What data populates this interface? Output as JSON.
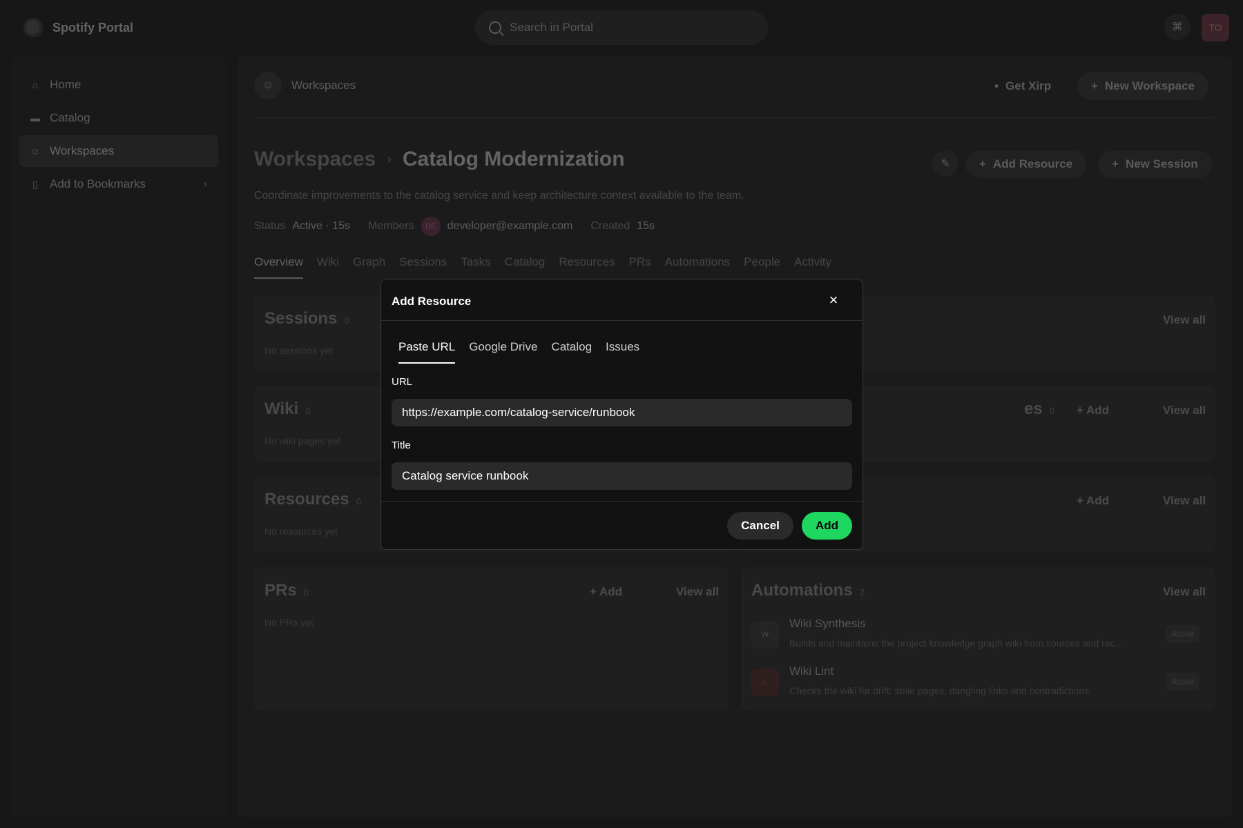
{
  "app": {
    "name": "Spotify Portal"
  },
  "topbar": {
    "search_placeholder": "Search in Portal",
    "avatar_initials": "TO"
  },
  "sidebar": {
    "items": [
      {
        "label": "Home",
        "icon": "home-icon"
      },
      {
        "label": "Catalog",
        "icon": "folder-icon"
      },
      {
        "label": "Workspaces",
        "icon": "users-icon",
        "active": true
      },
      {
        "label": "Add to Bookmarks",
        "icon": "bookmark-icon"
      }
    ]
  },
  "header": {
    "title": "Workspaces",
    "get_xirp": "Get Xirp",
    "new_workspace": "New Workspace"
  },
  "workspace": {
    "breadcrumb_parent": "Workspaces",
    "name": "Catalog Modernization",
    "add_resource": "Add Resource",
    "new_session": "New Session",
    "description": "Coordinate improvements to the catalog service and keep architecture context available to the team.",
    "status_label": "Status",
    "status_value": "Active · 15s",
    "members_label": "Members",
    "member_initials": "DE",
    "member_email": "developer@example.com",
    "created_label": "Created",
    "created_value": "15s"
  },
  "tabs": [
    "Overview",
    "Wiki",
    "Graph",
    "Sessions",
    "Tasks",
    "Catalog",
    "Resources",
    "PRs",
    "Automations",
    "People",
    "Activity"
  ],
  "cards": {
    "sessions": {
      "title": "Sessions",
      "count": "0",
      "empty": "No sessions yet"
    },
    "wiki": {
      "title": "Wiki",
      "count": "0",
      "empty": "No wiki pages yet"
    },
    "resources": {
      "title": "Resources",
      "count": "0",
      "empty": "No resources yet"
    },
    "prs": {
      "title": "PRs",
      "count": "0",
      "empty": "No PRs yet"
    },
    "right2": {
      "title_fragment": "es",
      "count": "0"
    },
    "automations": {
      "title": "Automations",
      "count": "2",
      "items": [
        {
          "initial": "W",
          "name": "Wiki Synthesis",
          "desc": "Builds and maintains the project knowledge graph wiki from sources and rec...",
          "badge": "Active"
        },
        {
          "initial": "L",
          "name": "Wiki Lint",
          "desc": "Checks the wiki for drift: stale pages, dangling links and contradictions.",
          "badge": "Active"
        }
      ]
    },
    "view_all": "View all",
    "add": "Add"
  },
  "modal": {
    "title": "Add Resource",
    "tabs": [
      "Paste URL",
      "Google Drive",
      "Catalog",
      "Issues"
    ],
    "url_label": "URL",
    "url_value": "https://example.com/catalog-service/runbook",
    "title_label": "Title",
    "title_value": "Catalog service runbook",
    "cancel": "Cancel",
    "add": "Add"
  },
  "colors": {
    "accent": "#1ed760",
    "background": "#1d1d1d",
    "modal_bg": "#121212"
  }
}
